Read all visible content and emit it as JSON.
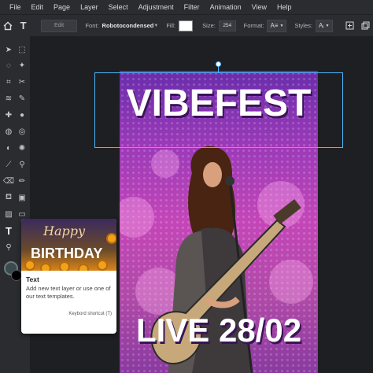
{
  "menu": [
    "File",
    "Edit",
    "Page",
    "Layer",
    "Select",
    "Adjustment",
    "Filter",
    "Animation",
    "View",
    "Help"
  ],
  "toolbar": {
    "edit_label": "Edit",
    "font_label": "Font:",
    "font_value": "Robotocondensed",
    "fill_label": "Fill:",
    "fill_color": "#ffffff",
    "size_label": "Size:",
    "size_value": "254",
    "format_label": "Format:",
    "styles_label": "Styles:"
  },
  "poster": {
    "title": "VIBEFEST",
    "subtitle": "LIVE 28/02"
  },
  "tooltip": {
    "image_happy": "Happy",
    "image_birthday": "BIRTHDAY",
    "title": "Text",
    "description": "Add new text layer or use one of our text templates.",
    "shortcut": "Keybord shortcut (T)"
  },
  "colors": {
    "accent": "#4db8ff",
    "ui_bg": "#2b2c30",
    "canvas_bg": "#1e1f22"
  }
}
